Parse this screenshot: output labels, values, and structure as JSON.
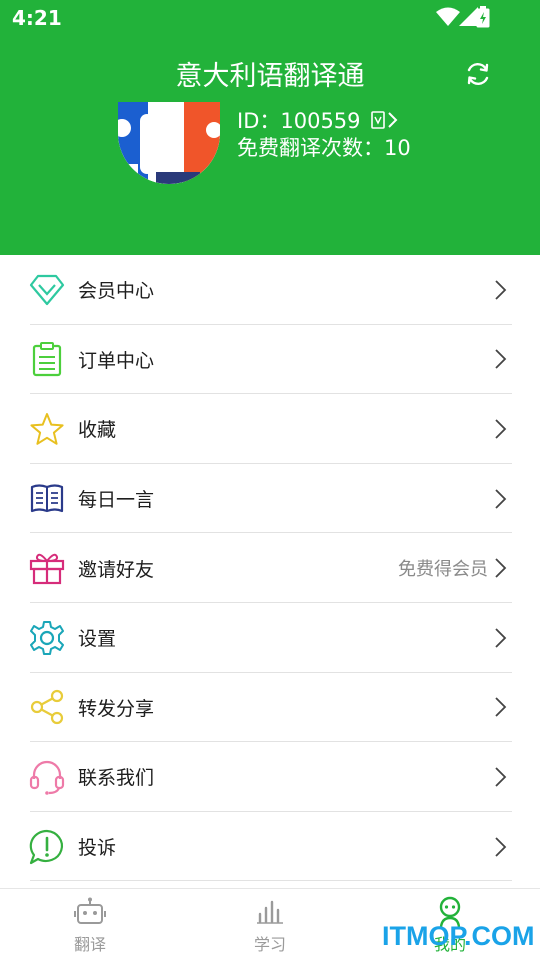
{
  "status_bar": {
    "time": "4:21"
  },
  "header": {
    "title": "意大利语翻译通",
    "id_text": "ID：100559",
    "free_count_text": "免费翻译次数：10"
  },
  "menu": {
    "items": [
      {
        "label": "会员中心",
        "hint": "",
        "icon": "diamond-icon"
      },
      {
        "label": "订单中心",
        "hint": "",
        "icon": "clipboard-icon"
      },
      {
        "label": "收藏",
        "hint": "",
        "icon": "star-icon"
      },
      {
        "label": "每日一言",
        "hint": "",
        "icon": "book-icon"
      },
      {
        "label": "邀请好友",
        "hint": "免费得会员",
        "icon": "gift-icon"
      },
      {
        "label": "设置",
        "hint": "",
        "icon": "gear-icon"
      },
      {
        "label": "转发分享",
        "hint": "",
        "icon": "share-icon"
      },
      {
        "label": "联系我们",
        "hint": "",
        "icon": "headset-icon"
      },
      {
        "label": "投诉",
        "hint": "",
        "icon": "complaint-icon"
      }
    ]
  },
  "bottom_nav": {
    "tabs": [
      {
        "label": "翻译",
        "icon": "robot-icon",
        "active": false
      },
      {
        "label": "学习",
        "icon": "bars-icon",
        "active": false
      },
      {
        "label": "我的",
        "icon": "person-icon",
        "active": true
      }
    ]
  },
  "watermark": "ITMOP.COM",
  "colors": {
    "brand_green": "#22b23a",
    "divider": "#e2e2e2",
    "hint_gray": "#8a8a8a",
    "watermark_blue": "#1aa3e8"
  }
}
